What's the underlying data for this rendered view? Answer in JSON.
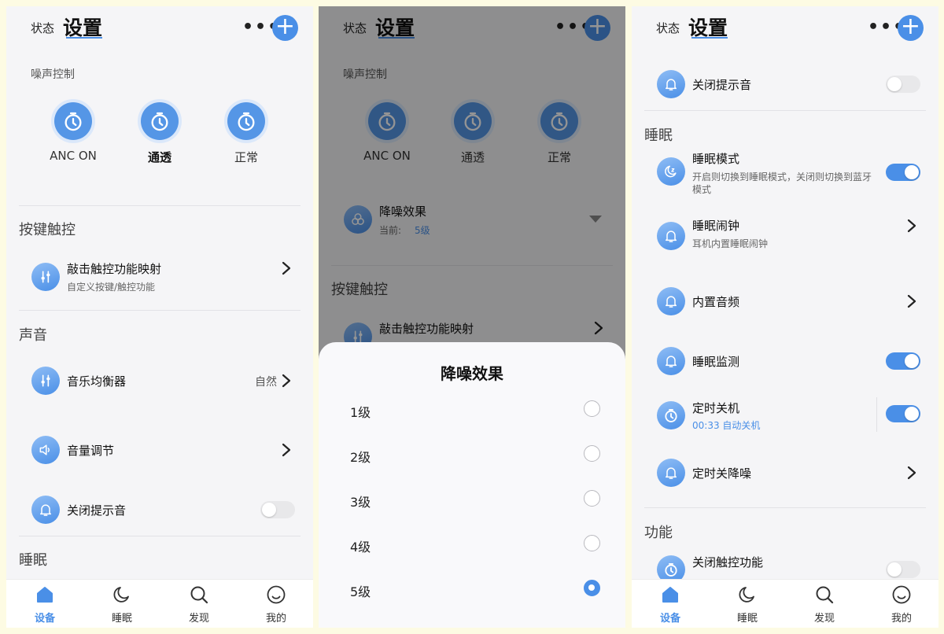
{
  "header": {
    "status_label": "状态",
    "title": "设置",
    "more_label": "•••",
    "add_label": "+"
  },
  "noise": {
    "section": "噪声控制",
    "modes": [
      {
        "label": "ANC ON",
        "icon": "timer-icon"
      },
      {
        "label": "通透",
        "icon": "timer-icon"
      },
      {
        "label": "正常",
        "icon": "timer-icon"
      }
    ],
    "effect": {
      "title": "降噪效果",
      "current_label": "当前:",
      "current_value": "5级"
    }
  },
  "keys": {
    "section": "按键触控",
    "tap": {
      "title": "敲击触控功能映射",
      "subtitle": "自定义按键/触控功能"
    }
  },
  "sound": {
    "section": "声音",
    "eq": {
      "title": "音乐均衡器",
      "value": "自然"
    },
    "volume": {
      "title": "音量调节"
    },
    "prompt": {
      "title": "关闭提示音",
      "enabled": false
    }
  },
  "sleep": {
    "section": "睡眠",
    "mode": {
      "title": "睡眠模式",
      "desc": "开启则切换到睡眠模式，关闭则切换到蓝牙模式",
      "enabled": true
    },
    "alarm": {
      "title": "睡眠闹钟",
      "subtitle": "耳机内置睡眠闹钟"
    },
    "audio": {
      "title": "内置音频"
    },
    "monitor": {
      "title": "睡眠监测",
      "enabled": true
    },
    "timer": {
      "title": "定时关机",
      "subtitle": "00:33 自动关机",
      "enabled": true
    },
    "timer_anc": {
      "title": "定时关降噪"
    }
  },
  "features": {
    "section": "功能",
    "touch_off": {
      "title": "关闭触控功能",
      "enabled": false
    }
  },
  "sheet": {
    "title": "降噪效果",
    "options": [
      "1级",
      "2级",
      "3级",
      "4级",
      "5级"
    ],
    "selected_index": 4
  },
  "tabs": [
    {
      "label": "设备",
      "icon": "home-icon",
      "active": true
    },
    {
      "label": "睡眠",
      "icon": "moon-icon",
      "active": false
    },
    {
      "label": "发现",
      "icon": "search-icon",
      "active": false
    },
    {
      "label": "我的",
      "icon": "smile-icon",
      "active": false
    }
  ],
  "colors": {
    "accent": "#4a8fe7",
    "background": "#f5f5f7",
    "frame": "#fdfbe3"
  }
}
